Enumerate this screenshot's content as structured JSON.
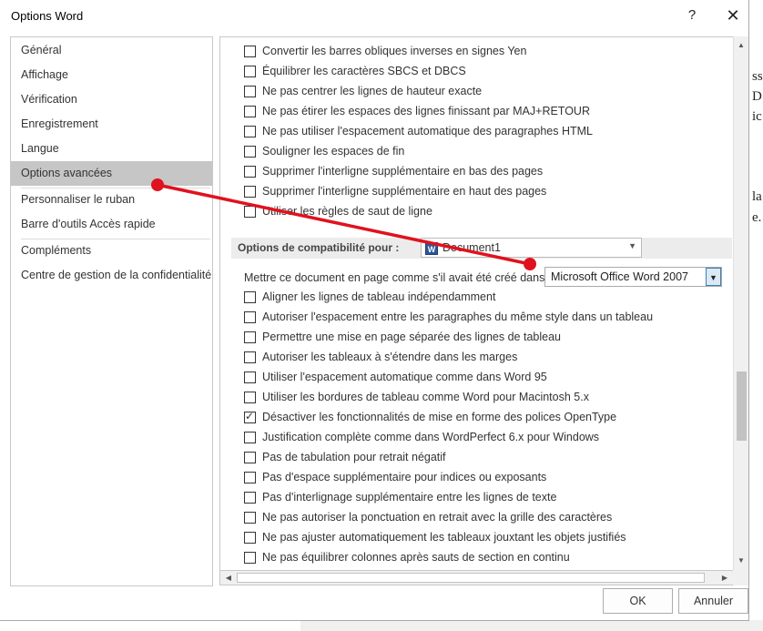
{
  "window": {
    "title": "Options Word",
    "help_glyph": "?",
    "close_glyph": "✕"
  },
  "background_fragments": [
    "ss",
    "D",
    "ic",
    "la",
    "e."
  ],
  "nav": {
    "items": [
      "Général",
      "Affichage",
      "Vérification",
      "Enregistrement",
      "Langue",
      "Options avancées",
      "Personnaliser le ruban",
      "Barre d'outils Accès rapide",
      "Compléments",
      "Centre de gestion de la confidentialité"
    ],
    "selected": "Options avancées"
  },
  "options_top": [
    {
      "label": "Convertir les barres obliques inverses en signes Yen",
      "checked": false
    },
    {
      "label": "Équilibrer les caractères SBCS et DBCS",
      "checked": false
    },
    {
      "label": "Ne pas centrer les lignes de hauteur exacte",
      "checked": false
    },
    {
      "label": "Ne pas étirer les espaces des lignes finissant par MAJ+RETOUR",
      "checked": false
    },
    {
      "label": "Ne pas utiliser l'espacement automatique des paragraphes HTML",
      "checked": false
    },
    {
      "label": "Souligner les espaces de fin",
      "checked": false
    },
    {
      "label": "Supprimer l'interligne supplémentaire en bas des pages",
      "checked": false
    },
    {
      "label": "Supprimer l'interligne supplémentaire en haut des pages",
      "checked": false
    },
    {
      "label": "Utiliser les règles de saut de ligne",
      "checked": false
    }
  ],
  "compat": {
    "label": "Options de compatibilité pour :",
    "document_icon": "W",
    "document": "Document1",
    "layout_label": "Mettre ce document en page comme s'il avait été créé dans :",
    "layout_value": "Microsoft Office Word 2007"
  },
  "options_compat": [
    {
      "label": "Aligner les lignes de tableau indépendamment",
      "checked": false
    },
    {
      "label": "Autoriser l'espacement entre les paragraphes du même style dans un tableau",
      "checked": false
    },
    {
      "label": "Permettre une mise en page séparée des lignes de tableau",
      "checked": false
    },
    {
      "label": "Autoriser les tableaux à s'étendre dans les marges",
      "checked": false
    },
    {
      "label": "Utiliser l'espacement automatique comme dans Word 95",
      "checked": false
    },
    {
      "label": "Utiliser les bordures de tableau comme Word pour Macintosh 5.x",
      "checked": false
    },
    {
      "label": "Désactiver les fonctionnalités de mise en forme des polices OpenType",
      "checked": true
    },
    {
      "label": "Justification complète comme dans WordPerfect 6.x pour Windows",
      "checked": false
    },
    {
      "label": "Pas de tabulation pour retrait négatif",
      "checked": false
    },
    {
      "label": "Pas d'espace supplémentaire pour indices ou exposants",
      "checked": false
    },
    {
      "label": "Pas d'interlignage supplémentaire entre les lignes de texte",
      "checked": false
    },
    {
      "label": "Ne pas autoriser la ponctuation en retrait avec la grille des caractères",
      "checked": false
    },
    {
      "label": "Ne pas ajuster automatiquement les tableaux jouxtant les objets justifiés",
      "checked": false
    },
    {
      "label": "Ne pas équilibrer colonnes après sauts de section en continu",
      "checked": false
    }
  ],
  "buttons": {
    "ok": "OK",
    "cancel": "Annuler"
  },
  "colors": {
    "annotation": "#e0121f",
    "selected_nav": "#c6c6c6",
    "word_blue": "#2b579a"
  },
  "icons": {
    "up": "▲",
    "down": "▼",
    "left": "◀",
    "right": "▶"
  }
}
